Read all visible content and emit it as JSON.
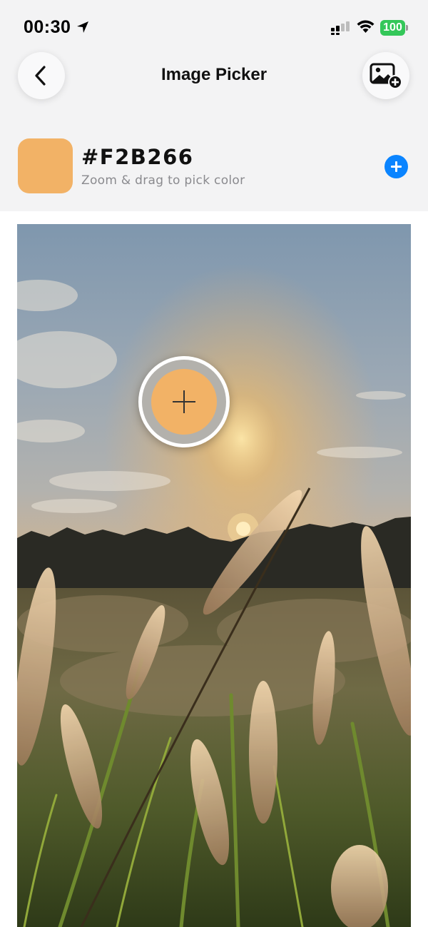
{
  "status_bar": {
    "time": "00:30",
    "battery": "100",
    "icons": [
      "location-arrow-icon",
      "signal-icon",
      "wifi-icon",
      "battery-icon"
    ]
  },
  "nav": {
    "title": "Image Picker",
    "back_icon": "chevron-left-icon",
    "add_image_icon": "photo-add-icon"
  },
  "picker": {
    "hex": "#F2B266",
    "hint": "Zoom & drag to pick color",
    "swatch_color": "#F2B266",
    "add_icon": "plus-circle-icon",
    "accent": "#0A84FF"
  },
  "photo": {
    "icon": "sunset-grass-photo"
  }
}
